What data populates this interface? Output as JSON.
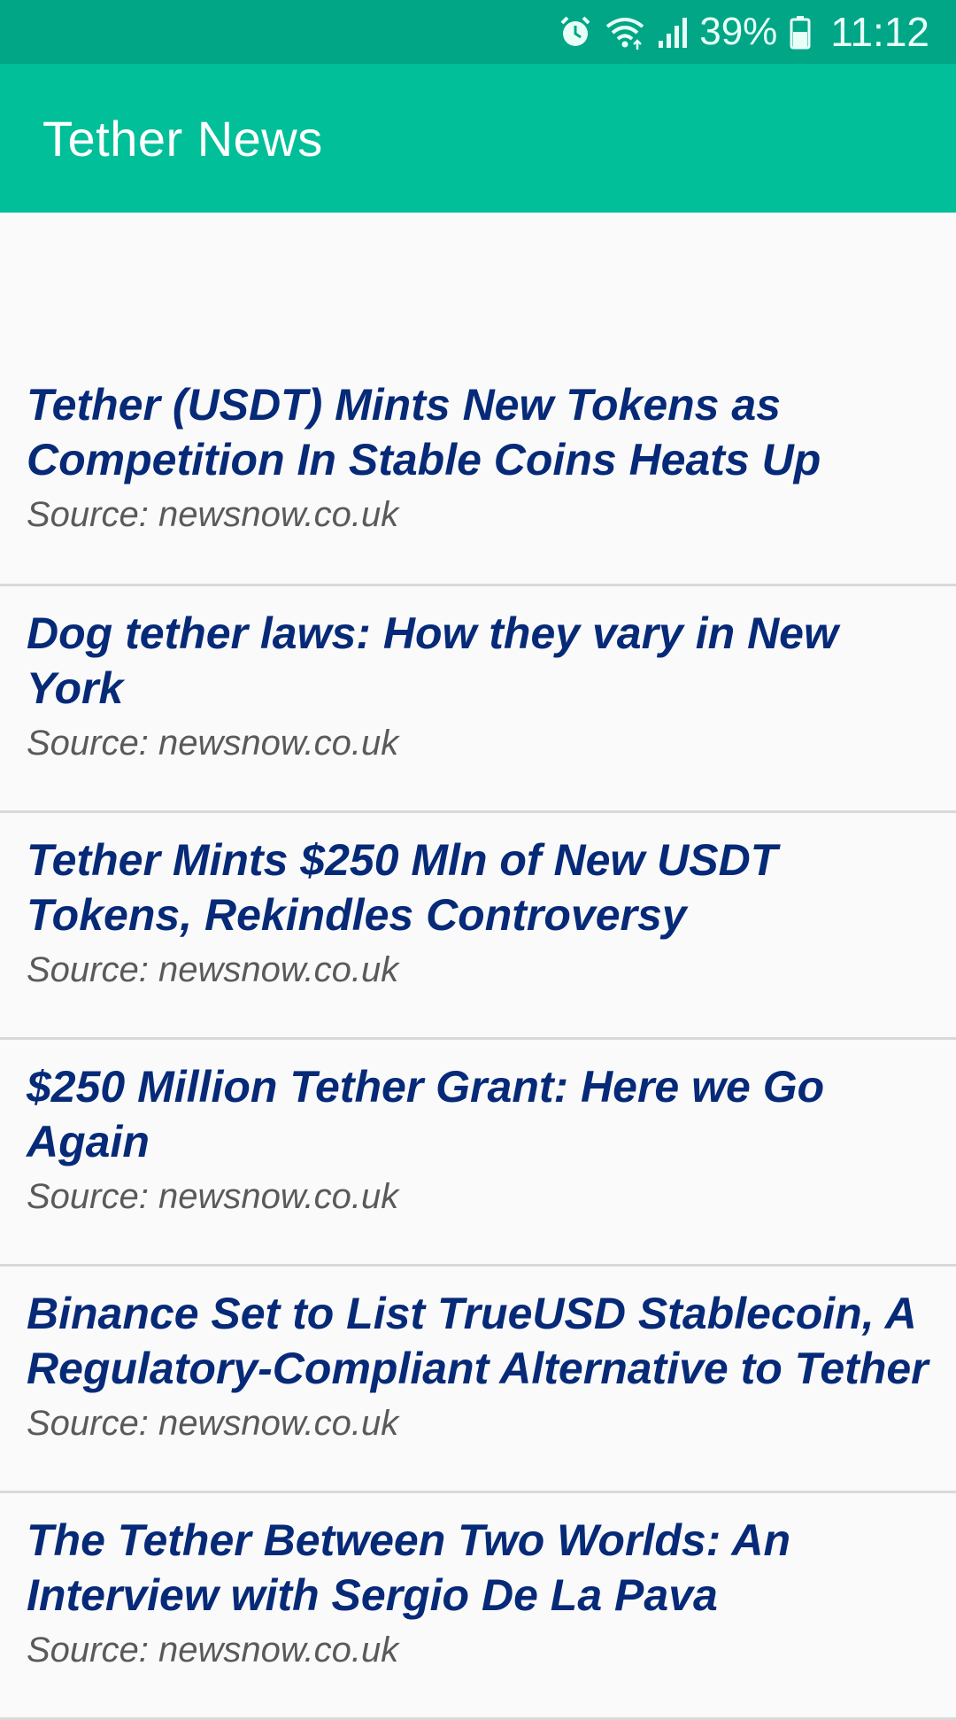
{
  "status_bar": {
    "icons": [
      "alarm-icon",
      "wifi-icon",
      "signal-icon",
      "battery-icon"
    ],
    "battery_percent": "39%",
    "time": "11:12"
  },
  "app_bar": {
    "title": "Tether News"
  },
  "colors": {
    "status_bar": "#00a685",
    "app_bar": "#00bf99",
    "title_text": "#062a78",
    "source_text": "#5a5a5a"
  },
  "news": [
    {
      "title": "Tether (USDT) Mints New Tokens as Competition In Stable Coins Heats Up",
      "source": "Source: newsnow.co.uk"
    },
    {
      "title": "Dog tether laws: How they vary in New York",
      "source": "Source: newsnow.co.uk"
    },
    {
      "title": "Tether Mints $250 Mln of New USDT Tokens, Rekindles Controversy",
      "source": "Source: newsnow.co.uk"
    },
    {
      "title": "$250 Million Tether Grant: Here we Go Again",
      "source": "Source: newsnow.co.uk"
    },
    {
      "title": "Binance Set to List TrueUSD Stablecoin, A Regulatory-Compliant Alternative to Tether",
      "source": "Source: newsnow.co.uk"
    },
    {
      "title": "The Tether Between Two Worlds: An Interview with Sergio De La Pava",
      "source": "Source: newsnow.co.uk"
    }
  ]
}
